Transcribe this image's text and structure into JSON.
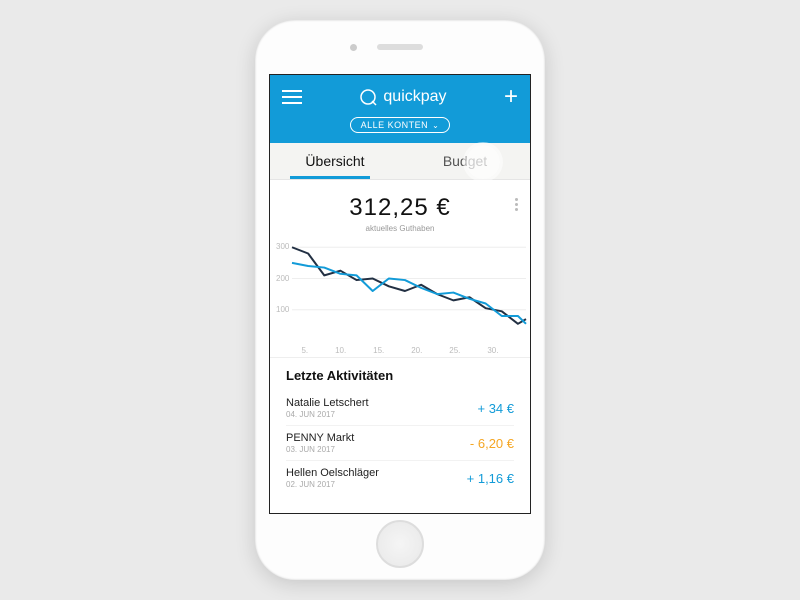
{
  "header": {
    "brand": "quickpay",
    "account_selector": "ALLE KONTEN"
  },
  "tabs": {
    "overview": "Übersicht",
    "budget": "Budget"
  },
  "balance": {
    "amount": "312,25 €",
    "subtitle": "aktuelles Guthaben"
  },
  "activities": {
    "title": "Letzte Aktivitäten",
    "items": [
      {
        "name": "Natalie Letschert",
        "date": "04. JUN 2017",
        "amount": "+ 34 €",
        "sign": "pos"
      },
      {
        "name": "PENNY Markt",
        "date": "03. JUN 2017",
        "amount": "- 6,20 €",
        "sign": "neg"
      },
      {
        "name": "Hellen Oelschläger",
        "date": "02. JUN 2017",
        "amount": "+ 1,16 €",
        "sign": "pos"
      }
    ]
  },
  "chart_data": {
    "type": "line",
    "xlabel": "",
    "ylabel": "",
    "ylim": [
      0,
      320
    ],
    "xlim": [
      1,
      30
    ],
    "x_ticks": [
      "5.",
      "10.",
      "15.",
      "20.",
      "25.",
      "30."
    ],
    "y_ticks": [
      100,
      200,
      300
    ],
    "series": [
      {
        "name": "dark",
        "color": "#223043",
        "x": [
          1,
          3,
          5,
          7,
          9,
          11,
          13,
          15,
          17,
          19,
          21,
          23,
          25,
          27,
          29,
          30
        ],
        "values": [
          300,
          280,
          210,
          225,
          195,
          200,
          175,
          160,
          180,
          150,
          130,
          140,
          105,
          95,
          55,
          70
        ]
      },
      {
        "name": "blue",
        "color": "#129bd8",
        "x": [
          1,
          3,
          5,
          7,
          9,
          11,
          13,
          15,
          17,
          19,
          21,
          23,
          25,
          27,
          29,
          30
        ],
        "values": [
          250,
          240,
          235,
          215,
          210,
          160,
          200,
          195,
          170,
          150,
          155,
          135,
          120,
          80,
          80,
          55
        ]
      }
    ]
  }
}
